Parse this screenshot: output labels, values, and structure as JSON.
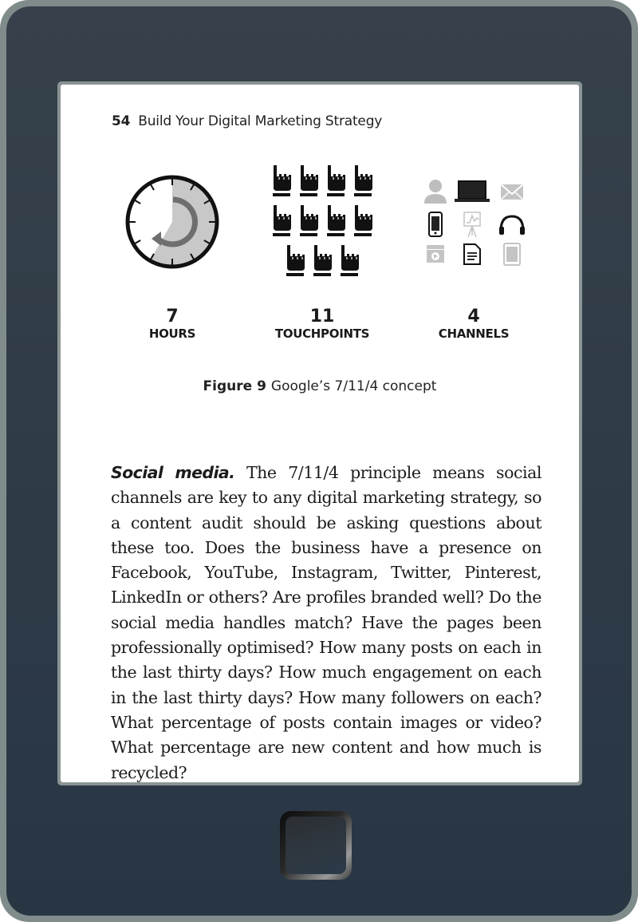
{
  "device": {
    "type": "e-reader",
    "frame_color": "#808c8b",
    "body_color": "#2f3b47",
    "home_button_label": "home-button"
  },
  "page": {
    "running_head": {
      "page_number": "54",
      "book_title": "Build Your Digital Marketing Strategy"
    },
    "figure": {
      "panels": [
        {
          "number": "7",
          "label": "HOURS",
          "graphic": "clock-icon",
          "clock_filled_hours": 7,
          "clock_total_hours": 12
        },
        {
          "number": "11",
          "label": "TOUCHPOINTS",
          "graphic": "pointing-hand-icons",
          "icon_count": 11,
          "rows": [
            4,
            4,
            3
          ]
        },
        {
          "number": "4",
          "label": "CHANNELS",
          "graphic": "channel-icons",
          "icons": [
            {
              "name": "person-icon",
              "highlighted": false
            },
            {
              "name": "laptop-icon",
              "highlighted": true
            },
            {
              "name": "envelope-icon",
              "highlighted": false
            },
            {
              "name": "smartphone-icon",
              "highlighted": true
            },
            {
              "name": "presentation-board-icon",
              "highlighted": false
            },
            {
              "name": "headphones-icon",
              "highlighted": true
            },
            {
              "name": "video-clapper-icon",
              "highlighted": false
            },
            {
              "name": "document-icon",
              "highlighted": true
            },
            {
              "name": "tablet-icon",
              "highlighted": false
            }
          ]
        }
      ],
      "caption_label": "Figure 9",
      "caption_text": "Google’s 7/11/4 concept"
    },
    "body": {
      "lead": "Social media.",
      "text": " The 7/11/4 principle means social channels are key to any digital marketing strategy, so a content audit should be asking questions about these too. Does the business have a presence on Facebook, YouTube, Instagram, Twitter, Pinterest, LinkedIn or others? Are profiles branded well? Do the social media handles match? Have the pages been professionally optimised? How many posts on each in the last thirty days? How much engagement on each in the last thirty days? How many followers on each? What percentage of posts contain images or video? What percentage are new content and how much is recycled?"
    }
  }
}
